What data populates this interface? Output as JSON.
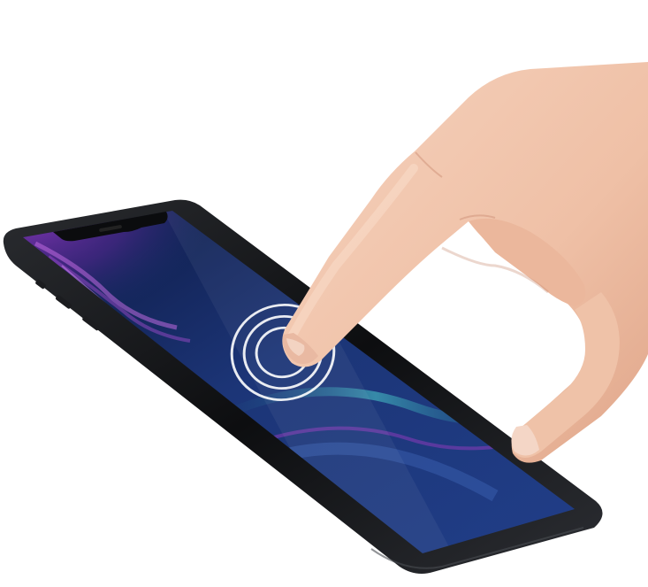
{
  "scene": {
    "subject": "hand-tapping-phone-screen-protector",
    "colors": {
      "background": "#ffffff",
      "phone_frame": "#111214",
      "screen_deep": "#0d1a4a",
      "screen_mid": "#1f3d86",
      "wallpaper_purple": "#8a3bb8",
      "wallpaper_teal": "#2b8fa3",
      "skin": "#f1c7ae",
      "skin_shadow": "#d79b80",
      "ripple": "#ffffff"
    },
    "icons": [
      "phone-illustration",
      "hand-illustration",
      "touch-ripple-icon"
    ]
  }
}
